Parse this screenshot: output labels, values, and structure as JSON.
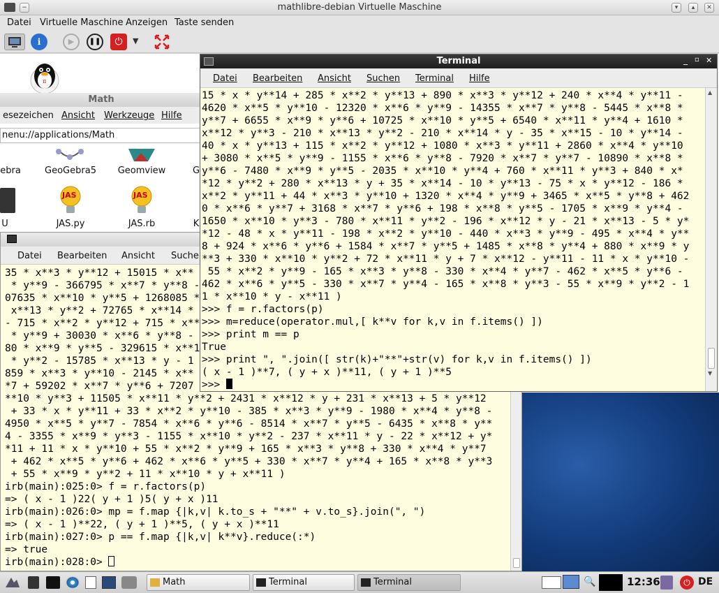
{
  "vm": {
    "title": "mathlibre-debian Virtuelle Maschine",
    "menu": [
      "Datei",
      "Virtuelle Maschine",
      "Anzeigen",
      "Taste senden"
    ]
  },
  "math_window": {
    "title": "Math",
    "menu": [
      "esezeichen",
      "Ansicht",
      "Werkzeuge",
      "Hilfe"
    ],
    "location": "nenu://applications/Math",
    "apps_row1": [
      "ebra",
      "GeoGebra5",
      "Geomview",
      "G"
    ],
    "apps_row2": [
      "U",
      "JAS.py",
      "JAS.rb",
      "K"
    ],
    "jas_icon_text": "JAS"
  },
  "back_terminal": {
    "menu": [
      "Datei",
      "Bearbeiten",
      "Ansicht",
      "Suche"
    ],
    "lines": [
      "35 * x**3 * y**12 + 15015 * x**",
      " * y**9 - 366795 * x**7 * y**8 -",
      "07635 * x**10 * y**5 + 1268085 *",
      " x**13 * y**2 + 72765 * x**14 * ",
      "- 715 * x**2 * y**12 + 715 * x**",
      " * y**9 + 30030 * x**6 * y**8 - ",
      "80 * x**9 * y**5 - 329615 * x**1",
      " * y**2 - 15785 * x**13 * y - 1",
      "859 * x**3 * y**10 - 2145 * x**",
      "*7 + 59202 * x**7 * y**6 + 7207",
      "**10 * y**3 + 11505 * x**11 * y**2 + 2431 * x**12 * y + 231 * x**13 + 5 * y**12",
      " + 33 * x * y**11 + 33 * x**2 * y**10 - 385 * x**3 * y**9 - 1980 * x**4 * y**8 -",
      "4950 * x**5 * y**7 - 7854 * x**6 * y**6 - 8514 * x**7 * y**5 - 6435 * x**8 * y**",
      "4 - 3355 * x**9 * y**3 - 1155 * x**10 * y**2 - 237 * x**11 * y - 22 * x**12 + y*",
      "*11 + 11 * x * y**10 + 55 * x**2 * y**9 + 165 * x**3 * y**8 + 330 * x**4 * y**7",
      " + 462 * x**5 * y**6 + 462 * x**6 * y**5 + 330 * x**7 * y**4 + 165 * x**8 * y**3",
      " + 55 * x**9 * y**2 + 11 * x**10 * y + x**11 )",
      "irb(main):025:0> f = r.factors(p)",
      "=> ( x - 1 )22( y + 1 )5( y + x )11",
      "irb(main):026:0> mp = f.map {|k,v| k.to_s + \"**\" + v.to_s}.join(\", \")",
      "=> ( x - 1 )**22, ( y + 1 )**5, ( y + x )**11",
      "irb(main):027:0> p == f.map {|k,v| k**v}.reduce(:*)",
      "=> true",
      "irb(main):028:0> "
    ]
  },
  "front_terminal": {
    "title": "Terminal",
    "menu": [
      "Datei",
      "Bearbeiten",
      "Ansicht",
      "Suchen",
      "Terminal",
      "Hilfe"
    ],
    "lines": [
      "15 * x * y**14 + 285 * x**2 * y**13 + 890 * x**3 * y**12 + 240 * x**4 * y**11 -",
      "4620 * x**5 * y**10 - 12320 * x**6 * y**9 - 14355 * x**7 * y**8 - 5445 * x**8 *",
      "y**7 + 6655 * x**9 * y**6 + 10725 * x**10 * y**5 + 6540 * x**11 * y**4 + 1610 *",
      "x**12 * y**3 - 210 * x**13 * y**2 - 210 * x**14 * y - 35 * x**15 - 10 * y**14 -",
      "40 * x * y**13 + 115 * x**2 * y**12 + 1080 * x**3 * y**11 + 2860 * x**4 * y**10",
      "+ 3080 * x**5 * y**9 - 1155 * x**6 * y**8 - 7920 * x**7 * y**7 - 10890 * x**8 *",
      "y**6 - 7480 * x**9 * y**5 - 2035 * x**10 * y**4 + 760 * x**11 * y**3 + 840 * x*",
      "*12 * y**2 + 280 * x**13 * y + 35 * x**14 - 10 * y**13 - 75 * x * y**12 - 186 *",
      "x**2 * y**11 + 44 * x**3 * y**10 + 1320 * x**4 * y**9 + 3465 * x**5 * y**8 + 462",
      "0 * x**6 * y**7 + 3168 * x**7 * y**6 + 198 * x**8 * y**5 - 1705 * x**9 * y**4 -",
      "1650 * x**10 * y**3 - 780 * x**11 * y**2 - 196 * x**12 * y - 21 * x**13 - 5 * y*",
      "*12 - 48 * x * y**11 - 198 * x**2 * y**10 - 440 * x**3 * y**9 - 495 * x**4 * y**",
      "8 + 924 * x**6 * y**6 + 1584 * x**7 * y**5 + 1485 * x**8 * y**4 + 880 * x**9 * y",
      "**3 + 330 * x**10 * y**2 + 72 * x**11 * y + 7 * x**12 - y**11 - 11 * x * y**10 -",
      " 55 * x**2 * y**9 - 165 * x**3 * y**8 - 330 * x**4 * y**7 - 462 * x**5 * y**6 -",
      "462 * x**6 * y**5 - 330 * x**7 * y**4 - 165 * x**8 * y**3 - 55 * x**9 * y**2 - 1",
      "1 * x**10 * y - x**11 )",
      ">>> f = r.factors(p)",
      ">>> m=reduce(operator.mul,[ k**v for k,v in f.items() ])",
      ">>> print m == p",
      "True",
      ">>> print \", \".join([ str(k)+\"**\"+str(v) for k,v in f.items() ])",
      "( x - 1 )**7, ( y + x )**11, ( y + 1 )**5",
      ">>> "
    ]
  },
  "taskbar": {
    "tasks": [
      "Math",
      "Terminal",
      "Terminal"
    ],
    "clock": "12:36",
    "lang": "DE"
  },
  "colors": {
    "terminal_bg": "#fffde0",
    "desktop_blue": "#1a4a8c",
    "power_red": "#d42020"
  }
}
